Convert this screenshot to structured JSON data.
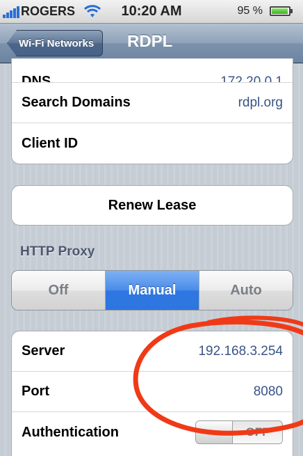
{
  "status_bar": {
    "carrier": "ROGERS",
    "time": "10:20 AM",
    "battery": "95 %"
  },
  "nav": {
    "back_label": "Wi-Fi Networks",
    "title": "RDPL"
  },
  "top_group": {
    "rows": [
      {
        "label": "DNS",
        "value": "172.20.0.1"
      },
      {
        "label": "Search Domains",
        "value": "rdpl.org"
      },
      {
        "label": "Client ID",
        "value": ""
      }
    ]
  },
  "renew_label": "Renew Lease",
  "http_proxy": {
    "header": "HTTP Proxy",
    "segments": [
      "Off",
      "Manual",
      "Auto"
    ],
    "selected": "Manual"
  },
  "proxy_group": {
    "server_label": "Server",
    "server_value": "192.168.3.254",
    "port_label": "Port",
    "port_value": "8080",
    "auth_label": "Authentication",
    "auth_toggle": "OFF"
  },
  "colors": {
    "accent_blue": "#2f77e0",
    "value_text": "#385487",
    "annotation_red": "#f03a17"
  }
}
